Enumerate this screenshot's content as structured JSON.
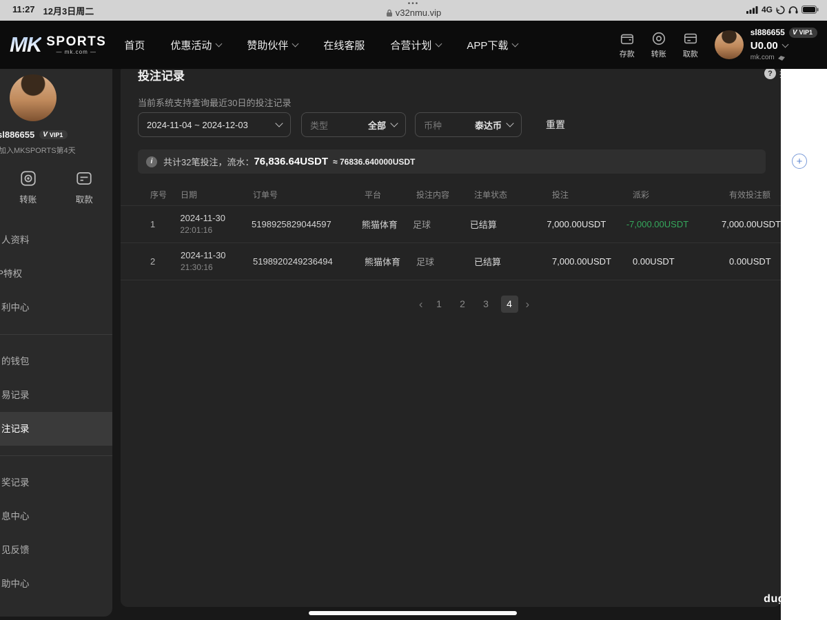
{
  "status_bar": {
    "time": "11:27",
    "date": "12月3日周二",
    "tab_dots": "•••",
    "url": "v32nmu.vip",
    "network": "4G"
  },
  "navbar": {
    "logo_mk": "MK",
    "logo_sports": "SPORTS",
    "logo_domain": "— mk.com —",
    "items": [
      {
        "label": "首页"
      },
      {
        "label": "优惠活动"
      },
      {
        "label": "赞助伙伴"
      },
      {
        "label": "在线客服"
      },
      {
        "label": "合营计划"
      },
      {
        "label": "APP下载"
      }
    ],
    "actions": [
      {
        "label": "存款"
      },
      {
        "label": "转账"
      },
      {
        "label": "取款"
      }
    ],
    "user": {
      "name": "sl886655",
      "vip_v": "V",
      "vip": "VIP1",
      "balance": "U0.00",
      "site": "mk.com"
    }
  },
  "sidebar": {
    "name": "sl886655",
    "vip_v": "V",
    "vip": "VIP1",
    "joined": "加入MKSPORTS第4天",
    "actions": [
      {
        "label": "转账"
      },
      {
        "label": "取款"
      }
    ],
    "groups": [
      {
        "items": [
          "人资料",
          "P特权",
          "利中心"
        ]
      },
      {
        "items": [
          "的钱包",
          "易记录",
          "注记录"
        ]
      },
      {
        "items": [
          "奖记录",
          "息中心",
          "见反馈",
          "助中心"
        ]
      }
    ],
    "active_item": "注记录"
  },
  "main": {
    "title": "投注记录",
    "help_mark": "?",
    "help_text": "投",
    "subtitle": "当前系统支持查询最近30日的投注记录",
    "filters": {
      "date_range": "2024-11-04 ~ 2024-12-03",
      "type_label": "类型",
      "type_value": "全部",
      "currency_label": "币种",
      "currency_value": "泰达币",
      "reset": "重置"
    },
    "summary": {
      "icon": "i",
      "prefix": "共计32笔投注，流水：",
      "amount": "76,836.64USDT",
      "approx": "≈ 76836.640000USDT"
    },
    "table": {
      "headers": [
        "序号",
        "日期",
        "订单号",
        "平台",
        "投注内容",
        "注单状态",
        "投注",
        "派彩",
        "有效投注额"
      ],
      "rows": [
        {
          "no": "1",
          "date": "2024-11-30",
          "time": "22:01:16",
          "order": "5198925829044597",
          "platform": "熊猫体育",
          "content": "足球",
          "status": "已结算",
          "bet": "7,000.00USDT",
          "payout": "-7,000.00USDT",
          "payout_color": "green",
          "valid": "7,000.00USDT"
        },
        {
          "no": "2",
          "date": "2024-11-30",
          "time": "21:30:16",
          "order": "5198920249236494",
          "platform": "熊猫体育",
          "content": "足球",
          "status": "已结算",
          "bet": "7,000.00USDT",
          "payout": "0.00USDT",
          "payout_color": "normal",
          "valid": "0.00USDT"
        }
      ]
    },
    "pagination": {
      "prev": "‹",
      "pages": [
        "1",
        "2",
        "3",
        "4"
      ],
      "active_index": 3,
      "next": "›"
    },
    "watermark": "dug"
  },
  "fab": {
    "plus": "+"
  },
  "colors": {
    "payout_green": "#35a85c",
    "fab_blue": "#5b85d0",
    "vip_badge_bg": "#3a3a3a",
    "card_bg": "#242424",
    "sidebar_bg": "#2a2a2a",
    "navbar_bg": "#0c0c0c"
  }
}
